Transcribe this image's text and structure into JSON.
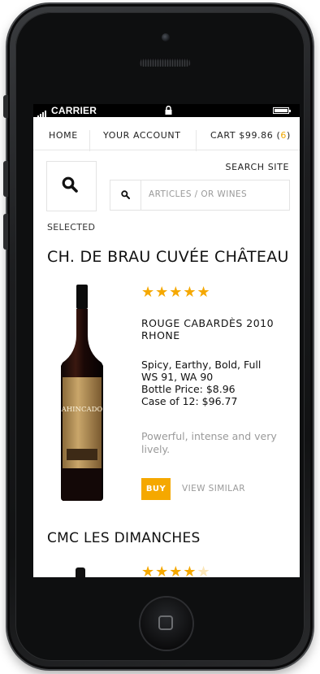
{
  "status_bar": {
    "carrier": "CARRIER"
  },
  "nav": {
    "home": "HOME",
    "account": "YOUR ACCOUNT",
    "cart_label": "CART $99.86 (",
    "cart_count": "6",
    "cart_close": ")"
  },
  "search": {
    "site_label": "SEARCH SITE",
    "placeholder": "ARTICLES / OR WINES"
  },
  "selected_label": "SELECTED",
  "products": [
    {
      "title": "CH. DE BRAU CUVÉE CHÂTEAU",
      "rating": 5,
      "stars_on": "★★★★★",
      "stars_off": "",
      "wine_name": "ROUGE CABARDÈS 2010 RHONE",
      "tasting": "Spicy, Earthy, Bold, Full",
      "scores": "WS 91, WA 90",
      "bottle_price": "Bottle Price: $8.96",
      "case_price": "Case of 12: $96.77",
      "description": "Powerful, intense and very lively.",
      "buy_label": "BUY",
      "similar_label": "VIEW SIMILAR",
      "label_text": "AHINCADO"
    },
    {
      "title": "CMC LES DIMANCHES",
      "rating": 4,
      "stars_on": "★★★★",
      "stars_off": "★"
    }
  ],
  "colors": {
    "accent": "#f5a800",
    "muted_text": "#9a9a9a",
    "border": "#e3e3e3"
  },
  "icons": [
    "search-icon",
    "lock-icon",
    "battery-icon",
    "signal-icon"
  ]
}
